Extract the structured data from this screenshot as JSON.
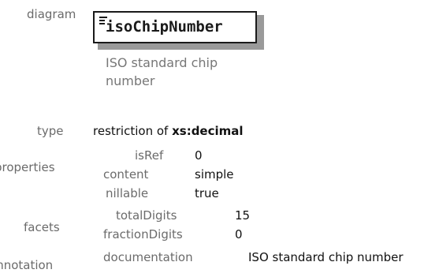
{
  "labels": {
    "diagram": "diagram",
    "type": "type",
    "properties": "properties",
    "facets": "facets",
    "annotation": "annotation"
  },
  "diagram": {
    "element_name": "isoChipNumber",
    "annotation_text": "ISO standard chip number",
    "icon": "element-icon"
  },
  "type": {
    "prefix": "restriction of",
    "base": "xs:decimal"
  },
  "properties": [
    {
      "key": "isRef",
      "value": "0"
    },
    {
      "key": "content",
      "value": "simple"
    },
    {
      "key": "nillable",
      "value": "true"
    }
  ],
  "facets": [
    {
      "key": "totalDigits",
      "value": "15"
    },
    {
      "key": "fractionDigits",
      "value": "0"
    }
  ],
  "annotation": {
    "key": "documentation",
    "value": "ISO standard chip number"
  }
}
